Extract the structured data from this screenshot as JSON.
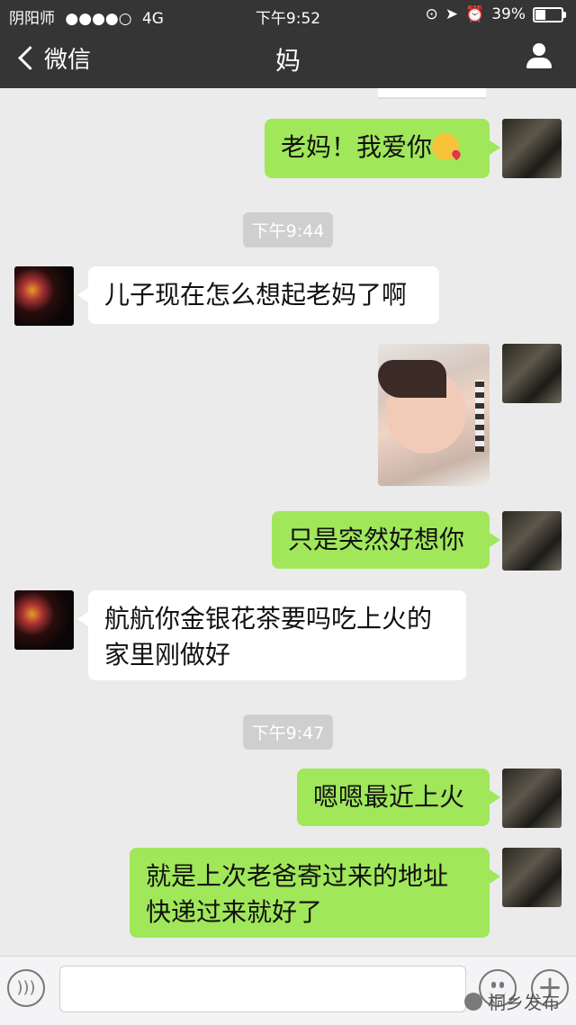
{
  "status": {
    "carrier": "阴阳师",
    "signal": "●●●●○",
    "network": "4G",
    "time": "下午9:52",
    "battery": "39%"
  },
  "nav": {
    "back_label": "微信",
    "title": "妈"
  },
  "messages": {
    "m1": "老妈！我爱你",
    "t1": "下午9:44",
    "m2": "儿子现在怎么想起老妈了啊",
    "m3": "只是突然好想你",
    "m4_line1": "航航你金银花茶要吗吃上火的",
    "m4_line2": "家里刚做好",
    "t2": "下午9:47",
    "m5": "嗯嗯最近上火",
    "m6_line1": "就是上次老爸寄过来的地址",
    "m6_line2": "快递过来就好了"
  },
  "watermark": "桐乡发布"
}
